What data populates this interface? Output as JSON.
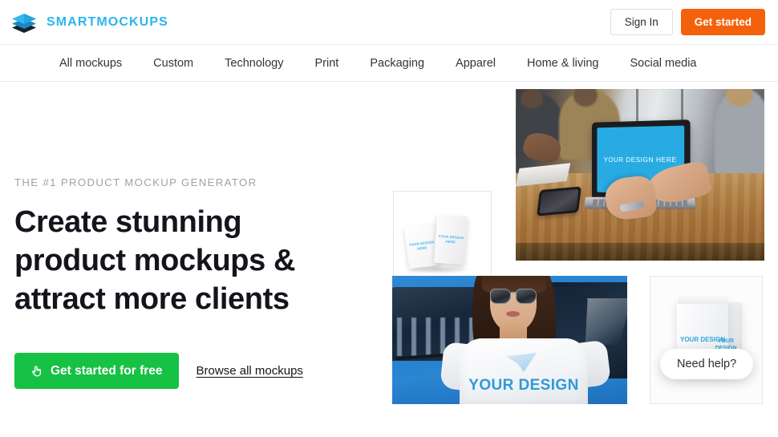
{
  "header": {
    "logo_icon": "layers-stack-icon",
    "brand": "SMARTMOCKUPS",
    "sign_in_label": "Sign In",
    "get_started_label": "Get started",
    "accent_orange": "#f4610c",
    "brand_blue": "#2bb6ec"
  },
  "nav": {
    "items": [
      {
        "label": "All mockups"
      },
      {
        "label": "Custom"
      },
      {
        "label": "Technology"
      },
      {
        "label": "Print"
      },
      {
        "label": "Packaging"
      },
      {
        "label": "Apparel"
      },
      {
        "label": "Home & living"
      },
      {
        "label": "Social media"
      }
    ]
  },
  "hero": {
    "eyebrow": "THE #1 PRODUCT MOCKUP GENERATOR",
    "headline": "Create stunning product mockups & attract more clients",
    "primary_cta": {
      "label": "Get started for free",
      "icon": "pointer-cursor-icon",
      "color": "#16c144"
    },
    "secondary_cta": {
      "label": "Browse all mockups"
    }
  },
  "gallery": {
    "business_cards": {
      "name": "business-cards-mockup",
      "overlay_front": "YOUR DESIGN HERE",
      "overlay_back": "YOUR DESIGN HERE"
    },
    "laptop": {
      "name": "laptop-mockup",
      "screen_text": "YOUR DESIGN HERE",
      "screen_color": "#28abe3"
    },
    "tshirt": {
      "name": "tshirt-mockup",
      "print_text": "YOUR DESIGN"
    },
    "pouch": {
      "name": "pouch-bag-mockup",
      "label_front": "YOUR DESIGN",
      "label_back": "YOUR DESIGN"
    }
  },
  "widgets": {
    "need_help": "Need help?"
  }
}
